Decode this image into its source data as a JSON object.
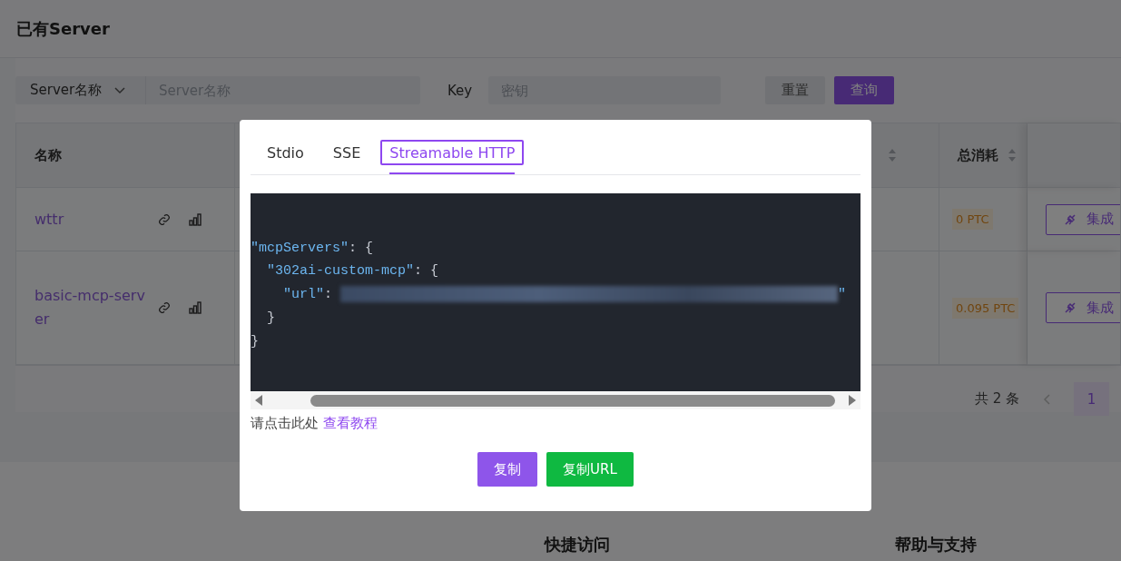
{
  "page": {
    "title": "已有Server"
  },
  "filters": {
    "field_select": "Server名称",
    "name_placeholder": "Server名称",
    "key_label": "Key",
    "key_placeholder": "密钥",
    "buttons": [
      {
        "label": "重置",
        "kind": "secondary"
      },
      {
        "label": "查询",
        "kind": "primary"
      }
    ]
  },
  "table": {
    "columns": [
      {
        "label": "名称",
        "sortable": false
      },
      {
        "label": "总消耗",
        "sortable": true
      }
    ],
    "rows": [
      {
        "name": "wttr",
        "cost": "0 PTC",
        "action": "集成"
      },
      {
        "name": "basic-mcp-server",
        "cost": "0.095 PTC",
        "action": "集成"
      }
    ]
  },
  "pagination": {
    "total": "共 2 条",
    "pages": [
      {
        "label": "1",
        "selected": true
      }
    ]
  },
  "footer": {
    "headings": [
      "快捷访问",
      "帮助与支持"
    ]
  },
  "modal": {
    "tabs": [
      {
        "label": "Stdio",
        "selected": false
      },
      {
        "label": "SSE",
        "selected": false
      },
      {
        "label": "Streamable HTTP",
        "selected": true
      }
    ],
    "code_lines": [
      [
        {
          "kind": "key",
          "text": "\"mcpServers\""
        },
        {
          "kind": "punct",
          "text": ": {"
        }
      ],
      [
        {
          "kind": "key",
          "text": "  \"302ai-custom-mcp\""
        },
        {
          "kind": "punct",
          "text": ": {"
        }
      ],
      [
        {
          "kind": "key",
          "text": "    \"url\""
        },
        {
          "kind": "punct",
          "text": ": "
        },
        {
          "kind": "redacted"
        },
        {
          "kind": "string",
          "text": "\""
        }
      ],
      [
        {
          "kind": "punct",
          "text": "  }"
        }
      ],
      [
        {
          "kind": "punct",
          "text": "}"
        }
      ]
    ],
    "hint": "请点击此处",
    "link": "查看教程",
    "buttons": [
      {
        "label": "复制",
        "kind": "primary"
      },
      {
        "label": "复制URL",
        "kind": "success"
      }
    ]
  }
}
